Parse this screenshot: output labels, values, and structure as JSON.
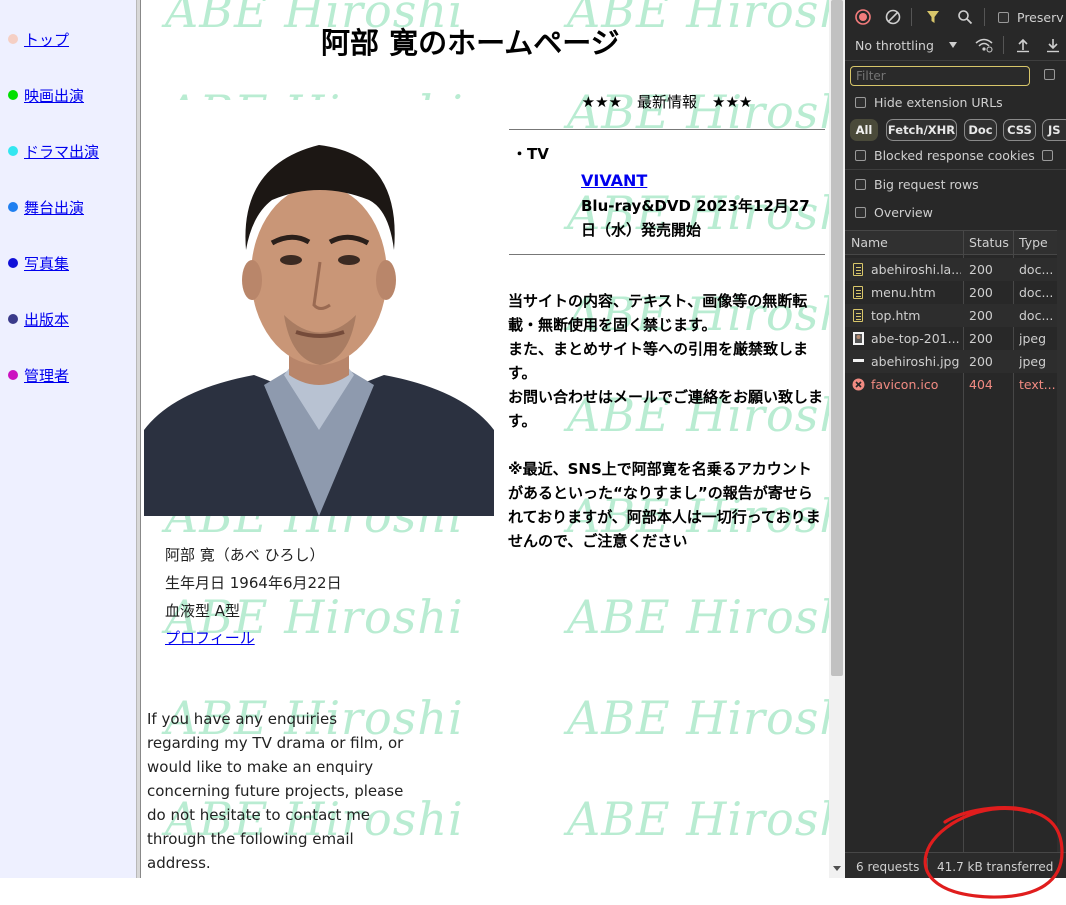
{
  "menu": {
    "items": [
      {
        "label": "トップ",
        "color": "#f5cfc4"
      },
      {
        "label": "映画出演",
        "color": "#00e000"
      },
      {
        "label": "ドラマ出演",
        "color": "#33e6f0"
      },
      {
        "label": "舞台出演",
        "color": "#1f7ff0"
      },
      {
        "label": "写真集",
        "color": "#1010d8"
      },
      {
        "label": "出版本",
        "color": "#3a3a8a"
      },
      {
        "label": "管理者",
        "color": "#cc10c0"
      }
    ]
  },
  "main": {
    "watermark_text": "ABE Hiroshi",
    "title": "阿部 寛のホームページ",
    "news_heading": "★★★　最新情報　★★★",
    "tv_label": "・TV",
    "vivant_link": "VIVANT",
    "release_text": "Blu-ray&DVD 2023年12月27日（水）発売開始",
    "notice_lines": [
      "当サイトの内容、テキスト、画像等の無断転載・無断使用を固く禁じます。",
      "また、まとめサイト等への引用を厳禁致します。",
      "お問い合わせはメールでご連絡をお願い致します。",
      "",
      "※最近、SNS上で阿部寛を名乗るアカウントがあるといった“なりすまし”の報告が寄せられておりますが、阿部本人は一切行っておりませんので、ご注意ください"
    ],
    "bio": {
      "name": "阿部 寛（あべ ひろし）",
      "birthday": "生年月日 1964年6月22日",
      "blood_type": "血液型 A型"
    },
    "profile_link": "プロフィール",
    "english_note": "If you have any enquiries regarding my TV drama or film, or would like to make an enquiry concerning future projects, please do not hesitate to contact me through the following email address."
  },
  "devtools": {
    "preserve_label": "Preserv",
    "throttling": "No throttling",
    "filter_placeholder": "Filter",
    "hide_extension_urls": "Hide extension URLs",
    "chips": [
      "All",
      "Fetch/XHR",
      "Doc",
      "CSS",
      "JS"
    ],
    "blocked_cookies": "Blocked response cookies",
    "big_request_rows": "Big request rows",
    "overview": "Overview",
    "columns": [
      "Name",
      "Status",
      "Type"
    ],
    "rows": [
      {
        "name": "abehiroshi.la....",
        "status": "200",
        "type": "doc...",
        "icon": "document-icon"
      },
      {
        "name": "menu.htm",
        "status": "200",
        "type": "doc...",
        "icon": "document-icon"
      },
      {
        "name": "top.htm",
        "status": "200",
        "type": "doc...",
        "icon": "document-icon"
      },
      {
        "name": "abe-top-201...",
        "status": "200",
        "type": "jpeg",
        "icon": "image-icon"
      },
      {
        "name": "abehiroshi.jpg",
        "status": "200",
        "type": "jpeg",
        "icon": "image-icon"
      },
      {
        "name": "favicon.ico",
        "status": "404",
        "type": "text...",
        "icon": "error-icon"
      }
    ],
    "requests_count": "6 requests",
    "transferred": "41.7 kB transferred",
    "colors": {
      "error": "#f28b82",
      "accent": "#d8c66a",
      "record": "#f47c7c"
    }
  }
}
